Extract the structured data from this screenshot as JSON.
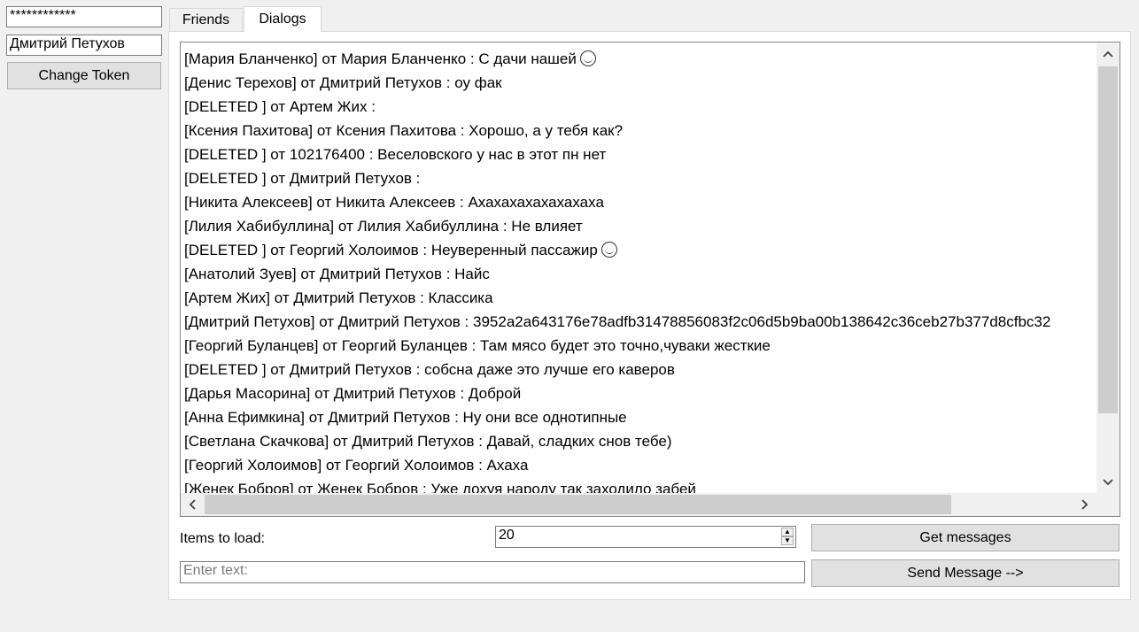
{
  "token": {
    "value": "************"
  },
  "user": {
    "name": "Дмитрий Петухов"
  },
  "buttons": {
    "change_token": "Change Token",
    "get_messages": "Get messages",
    "send_message": "Send Message -->"
  },
  "tabs": [
    {
      "label": "Friends",
      "active": false
    },
    {
      "label": "Dialogs",
      "active": true
    }
  ],
  "dialogs": [
    "[Мария Бланченко] от Мария Бланченко : С дачи нашей",
    "[Денис Терехов] от Дмитрий Петухов : оу фак",
    "[DELETED ] от Артем Жих :",
    "[Ксения Пахитова] от Ксения Пахитова : Хорошо, а у тебя как?",
    "[DELETED ] от 102176400 : Веселовского у нас в этот пн нет",
    "[DELETED ] от Дмитрий Петухов :",
    "[Никита Алексеев] от Никита Алексеев : Ахахахахахахахаха",
    "[Лилия Хабибуллина] от Лилия Хабибуллина : Не влияет",
    "[DELETED ] от Георгий Холоимов : Неуверенный пассажир",
    "[Анатолий Зуев] от Дмитрий Петухов : Найс",
    "[Артем Жих] от Дмитрий Петухов : Классика",
    "[Дмитрий Петухов] от Дмитрий Петухов : 3952a2a643176e78adfb31478856083f2c06d5b9ba00b138642c36ceb27b377d8cfbc32",
    "[Георгий Буланцев] от Георгий Буланцев : Там мясо будет это точно,чуваки жесткие",
    "[DELETED ] от Дмитрий Петухов : собсна даже это лучше его каверов",
    "[Дарья Масорина] от Дмитрий Петухов : Доброй",
    "[Анна Ефимкина] от Дмитрий Петухов : Ну они все однотипные",
    "[Светлана Скачкова] от Дмитрий Петухов : Давай, сладких снов тебе)",
    "[Георгий Холоимов] от Георгий Холоимов : Ахаха",
    "[Женек Бобров] от Женек Бобров : Уже дохуя народу так заходило забей"
  ],
  "emoji_rows": [
    0,
    8
  ],
  "items_to_load": {
    "label": "Items to load:",
    "value": "20"
  },
  "message_input": {
    "placeholder": "Enter text:",
    "value": ""
  },
  "icons": {
    "scroll_up": "chevron-up-icon",
    "scroll_down": "chevron-down-icon",
    "scroll_left": "chevron-left-icon",
    "scroll_right": "chevron-right-icon",
    "emoji": "emoji-face-icon"
  },
  "scroll": {
    "vertical_thumb_fraction": 0.86,
    "horizontal_thumb_fraction": 0.86
  }
}
